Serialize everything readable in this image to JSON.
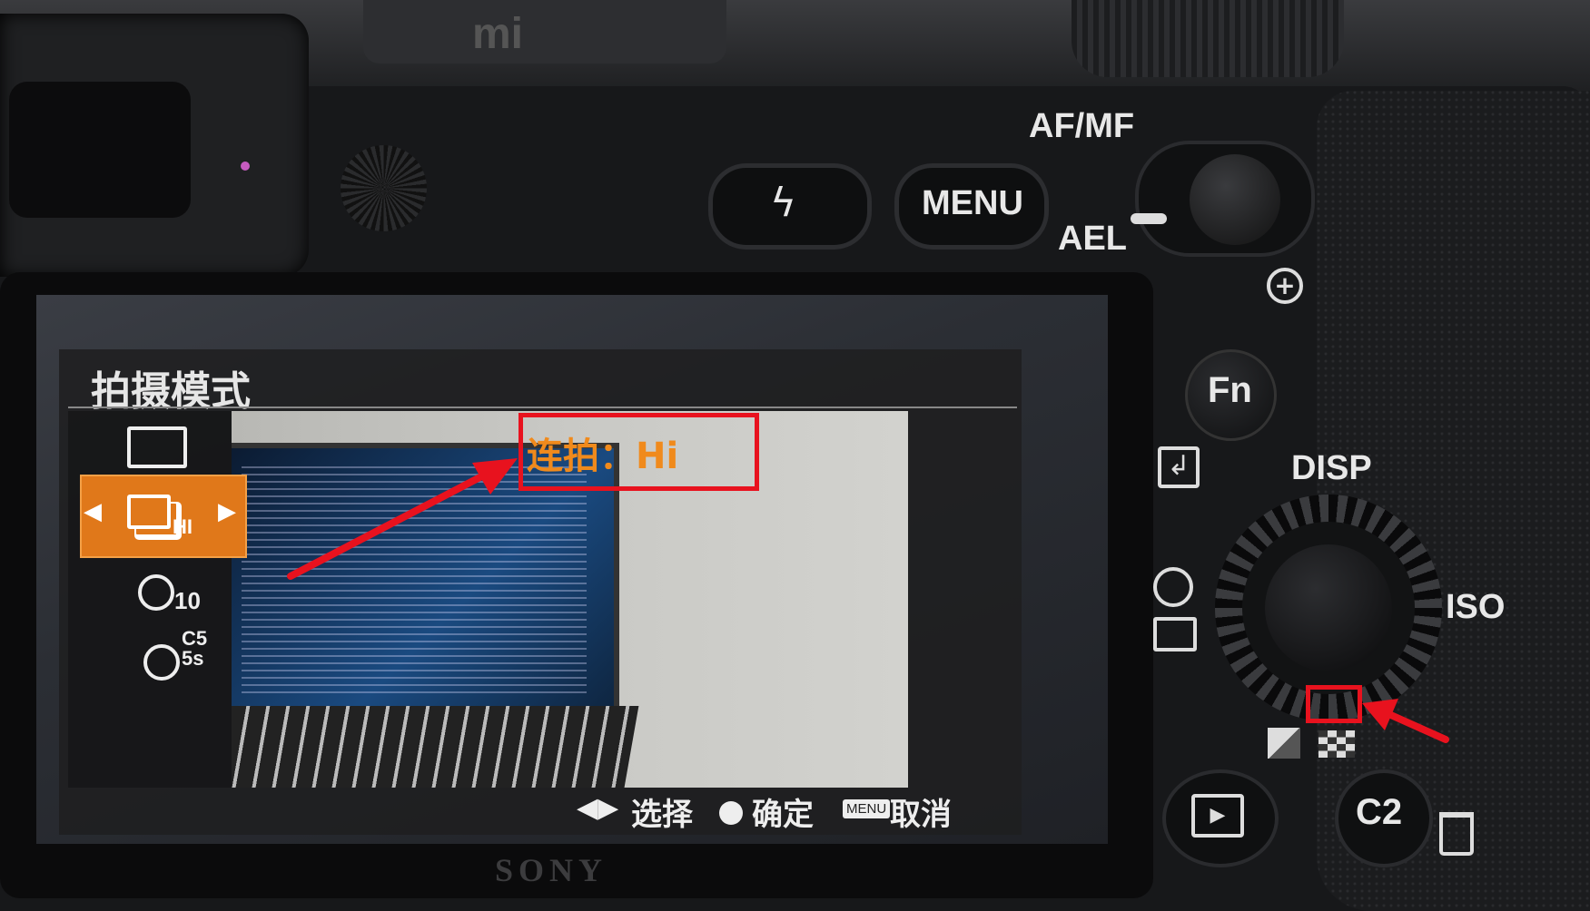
{
  "camera": {
    "brand": "SONY",
    "labels": {
      "afmf": "AF/MF",
      "ael": "AEL",
      "disp": "DISP",
      "iso": "ISO",
      "top_emboss": "mi"
    },
    "buttons": {
      "menu": "MENU",
      "fn": "Fn",
      "c2": "C2"
    }
  },
  "screen": {
    "title": "拍摄模式",
    "drive_modes": [
      {
        "label": "",
        "icon": "single-shot-icon"
      },
      {
        "label": "HI",
        "icon": "continuous-shooting-icon",
        "selected": true
      },
      {
        "label": "10",
        "icon": "self-timer-icon"
      },
      {
        "label": "C5\n5s",
        "icon": "self-timer-continuous-icon"
      }
    ],
    "current_mode_label": "连拍：Hi",
    "hints": {
      "select": "选择",
      "confirm": "确定",
      "menu_badge": "MENU",
      "cancel": "取消"
    }
  },
  "colors": {
    "highlight_orange": "#e0781a",
    "annotation_red": "#e8121e",
    "body": "#1a1b1d"
  }
}
